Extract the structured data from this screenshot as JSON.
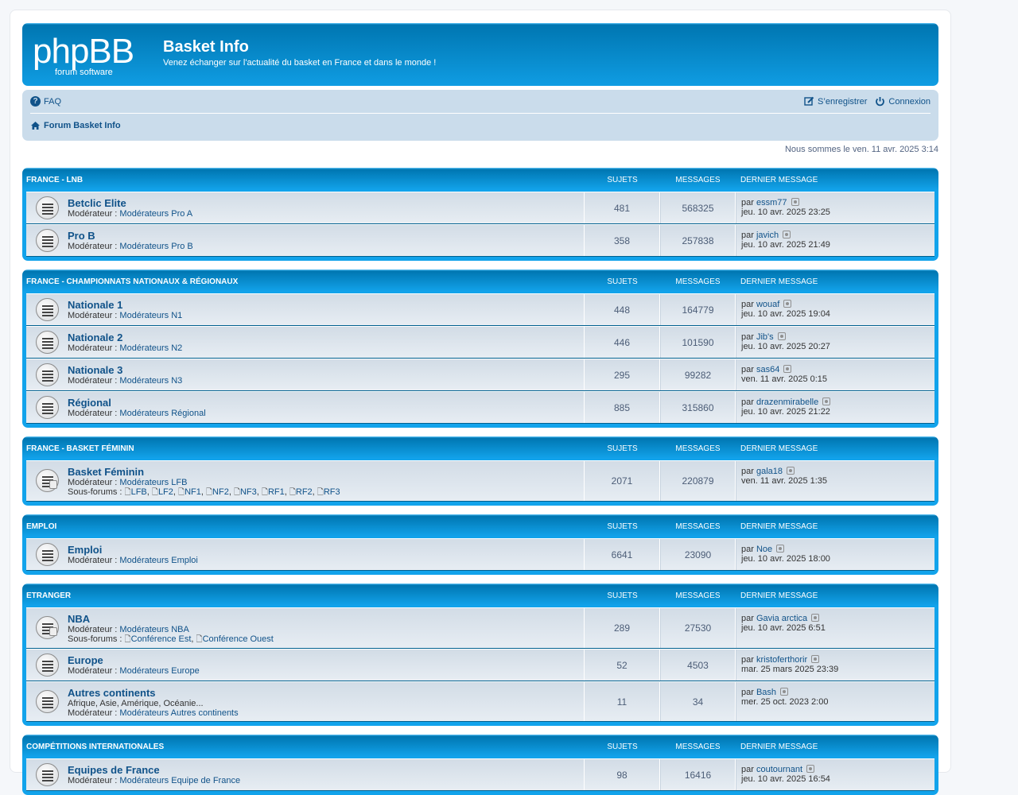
{
  "site": {
    "title": "Basket Info",
    "description": "Venez échanger sur l'actualité du basket en France et dans le monde !",
    "logo_main": "phpBB",
    "logo_sub": "forum  software"
  },
  "nav": {
    "faq": "FAQ",
    "register": "S’enregistrer",
    "login": "Connexion",
    "breadcrumb": "Forum Basket Info",
    "date": "Nous sommes le ven. 11 avr. 2025 3:14"
  },
  "columns": {
    "topics": "SUJETS",
    "posts": "MESSAGES",
    "last": "DERNIER MESSAGE"
  },
  "labels": {
    "moderator": "Modérateur : ",
    "subforums": "Sous-forums : ",
    "by": "par "
  },
  "categories": [
    {
      "name": "FRANCE - LNB",
      "forums": [
        {
          "title": "Betclic Elite",
          "mod": "Modérateurs Pro A",
          "topics": "481",
          "posts": "568325",
          "last_user": "essm77",
          "last_date": "jeu. 10 avr. 2025 23:25"
        },
        {
          "title": "Pro B",
          "mod": "Modérateurs Pro B",
          "topics": "358",
          "posts": "257838",
          "last_user": "javich",
          "last_date": "jeu. 10 avr. 2025 21:49"
        }
      ]
    },
    {
      "name": "FRANCE - CHAMPIONNATS NATIONAUX & RÉGIONAUX",
      "forums": [
        {
          "title": "Nationale 1",
          "mod": "Modérateurs N1",
          "topics": "448",
          "posts": "164779",
          "last_user": "wouaf",
          "last_date": "jeu. 10 avr. 2025 19:04"
        },
        {
          "title": "Nationale 2",
          "mod": "Modérateurs N2",
          "topics": "446",
          "posts": "101590",
          "last_user": "Jib's",
          "last_date": "jeu. 10 avr. 2025 20:27"
        },
        {
          "title": "Nationale 3",
          "mod": "Modérateurs N3",
          "topics": "295",
          "posts": "99282",
          "last_user": "sas64",
          "last_date": "ven. 11 avr. 2025 0:15"
        },
        {
          "title": "Régional",
          "mod": "Modérateurs Régional",
          "topics": "885",
          "posts": "315860",
          "last_user": "drazenmirabelle",
          "last_date": "jeu. 10 avr. 2025 21:22"
        }
      ]
    },
    {
      "name": "FRANCE - BASKET FÉMININ",
      "forums": [
        {
          "title": "Basket Féminin",
          "mod": "Modérateurs LFB",
          "subforums": [
            "LFB",
            "LF2",
            "NF1",
            "NF2",
            "NF3",
            "RF1",
            "RF2",
            "RF3"
          ],
          "topics": "2071",
          "posts": "220879",
          "last_user": "gala18",
          "last_date": "ven. 11 avr. 2025 1:35"
        }
      ]
    },
    {
      "name": "EMPLOI",
      "forums": [
        {
          "title": "Emploi",
          "mod": "Modérateurs Emploi",
          "topics": "6641",
          "posts": "23090",
          "last_user": "Noe",
          "last_date": "jeu. 10 avr. 2025 18:00"
        }
      ]
    },
    {
      "name": "ETRANGER",
      "forums": [
        {
          "title": "NBA",
          "mod": "Modérateurs NBA",
          "subforums": [
            "Conférence Est",
            "Conférence Ouest"
          ],
          "topics": "289",
          "posts": "27530",
          "last_user": "Gavia arctica",
          "last_date": "jeu. 10 avr. 2025 6:51"
        },
        {
          "title": "Europe",
          "mod": "Modérateurs Europe",
          "topics": "52",
          "posts": "4503",
          "last_user": "kristoferthorir",
          "last_date": "mar. 25 mars 2025 23:39"
        },
        {
          "title": "Autres continents",
          "desc": "Afrique, Asie, Amérique, Océanie...",
          "mod": "Modérateurs Autres continents",
          "topics": "11",
          "posts": "34",
          "last_user": "Bash",
          "last_date": "mer. 25 oct. 2023 2:00"
        }
      ]
    },
    {
      "name": "COMPÉTITIONS INTERNATIONALES",
      "forums": [
        {
          "title": "Equipes de France",
          "mod": "Modérateurs Equipe de France",
          "topics": "98",
          "posts": "16416",
          "last_user": "coutournant",
          "last_date": "jeu. 10 avr. 2025 16:54"
        }
      ]
    }
  ]
}
